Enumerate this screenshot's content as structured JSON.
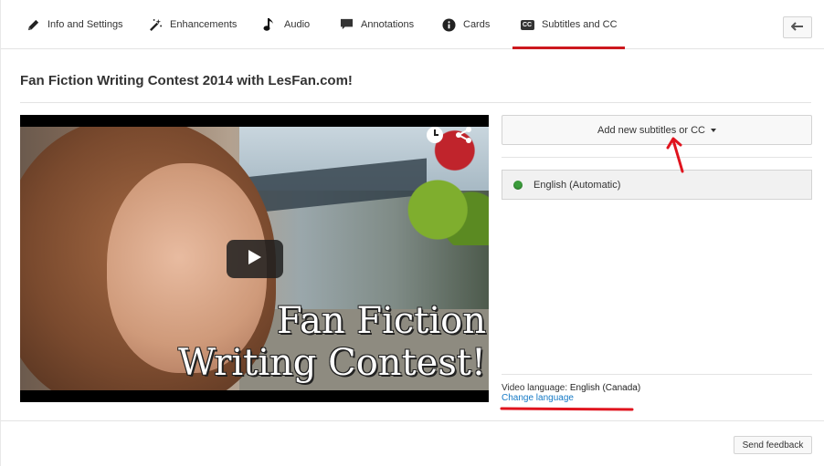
{
  "tabs": [
    {
      "label": "Info and Settings",
      "icon": "pencil-icon"
    },
    {
      "label": "Enhancements",
      "icon": "magic-wand-icon"
    },
    {
      "label": "Audio",
      "icon": "music-note-icon"
    },
    {
      "label": "Annotations",
      "icon": "speech-bubble-icon"
    },
    {
      "label": "Cards",
      "icon": "info-icon"
    },
    {
      "label": "Subtitles and CC",
      "icon": "cc-icon",
      "active": true
    }
  ],
  "cc_badge": "CC",
  "video_title": "Fan Fiction Writing Contest 2014 with LesFan.com!",
  "video": {
    "overlay_line1": "Fan Fiction",
    "overlay_line2": "Writing Contest!"
  },
  "subtitles": {
    "add_button_label": "Add new subtitles or CC",
    "tracks": [
      {
        "label": "English (Automatic)",
        "status_color": "#3a9c3a"
      }
    ],
    "video_language_label": "Video language:",
    "video_language_value": "English (Canada)",
    "change_language_link": "Change language"
  },
  "footer": {
    "send_feedback_label": "Send feedback"
  },
  "colors": {
    "accent_red": "#cc181e",
    "link_blue": "#167ac6",
    "annotation_red": "#e0141e"
  }
}
